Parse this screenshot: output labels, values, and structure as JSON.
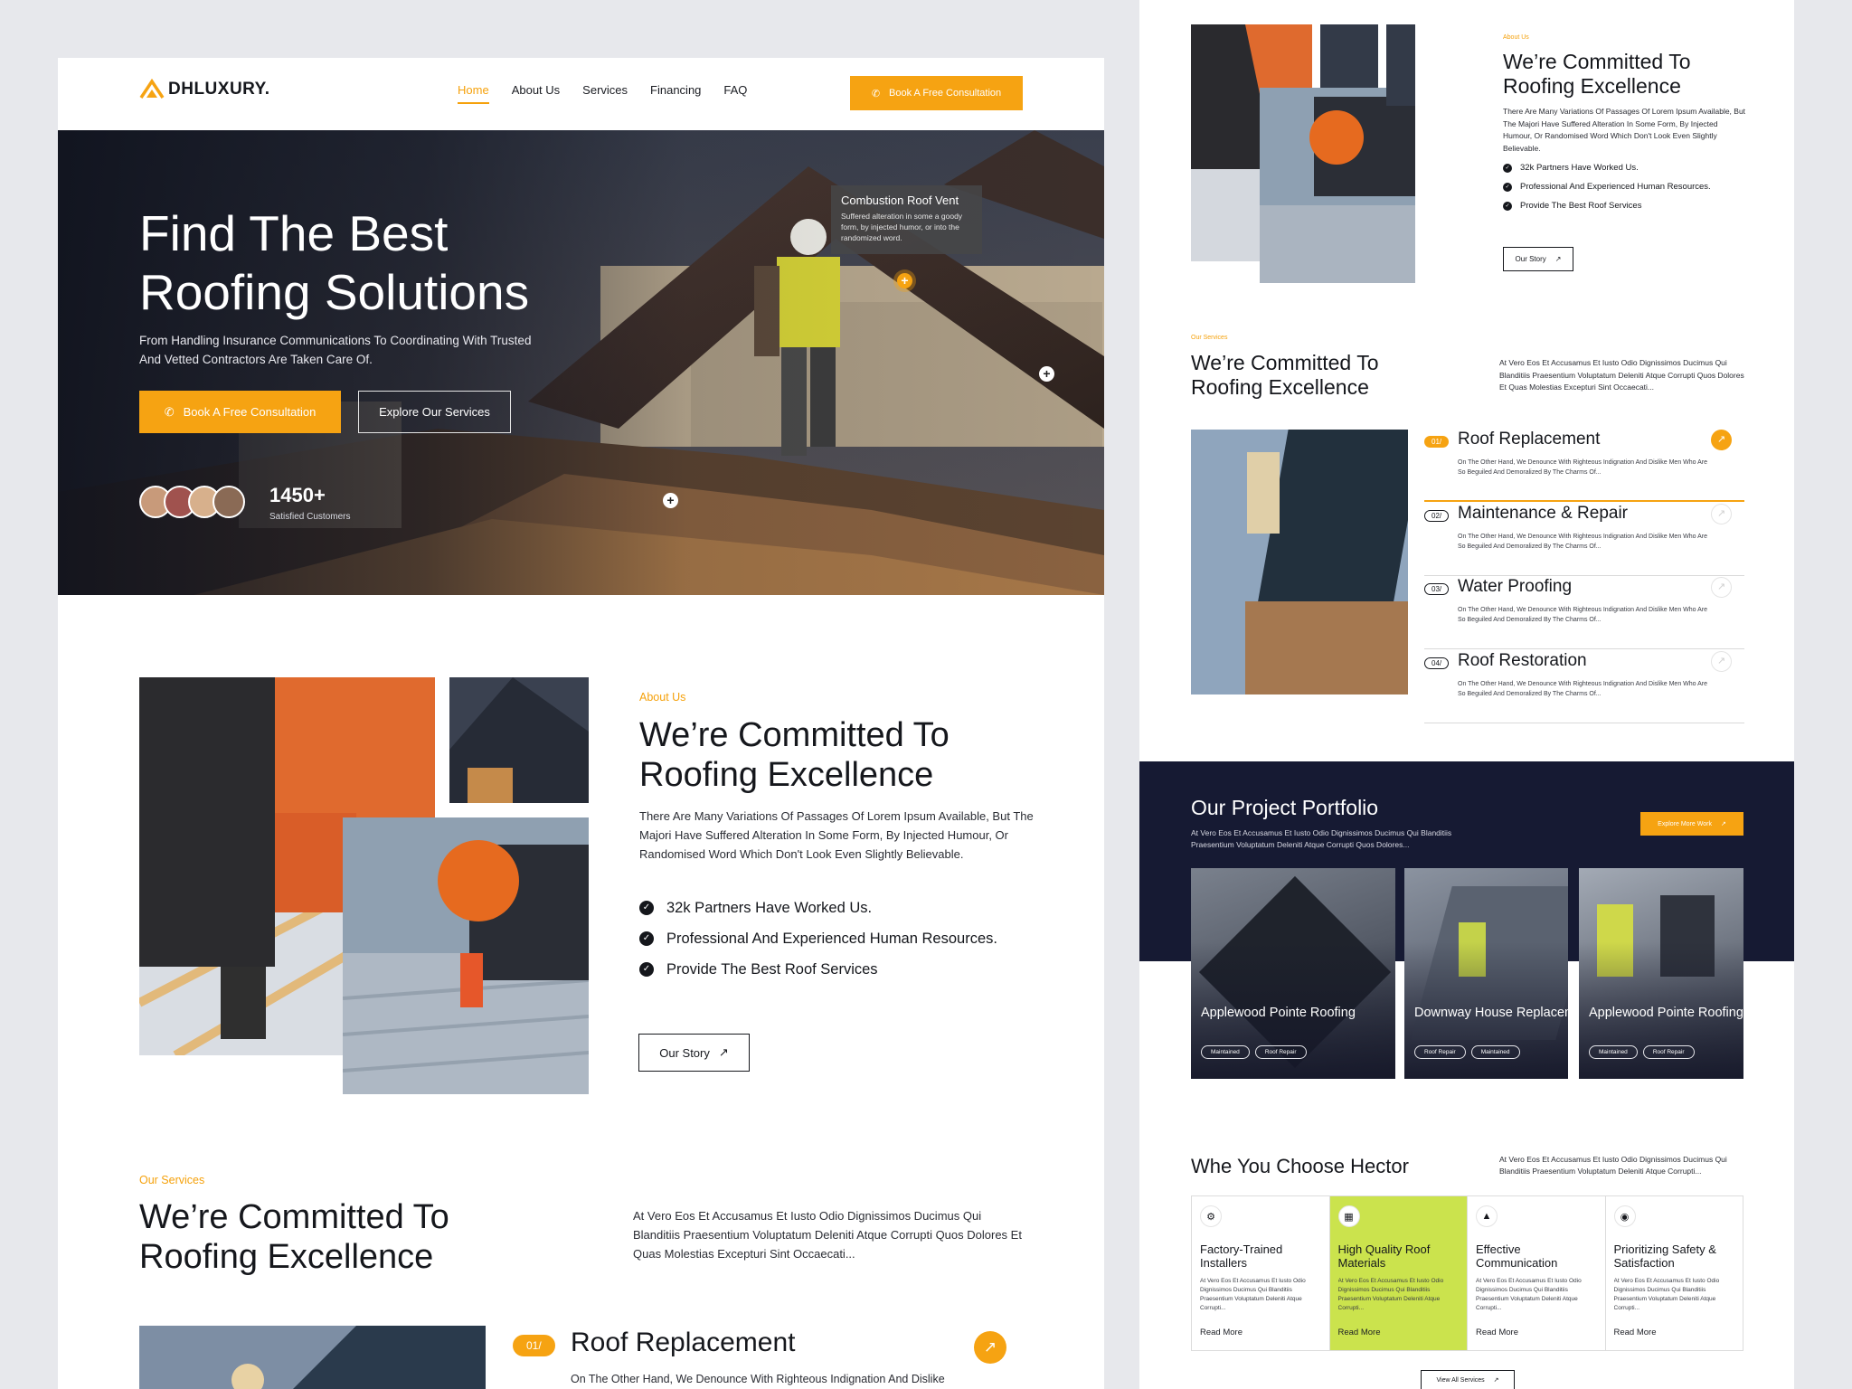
{
  "brand": {
    "name": "DHLUXURY.",
    "accent": "#f6a312",
    "dark": "#161a33",
    "highlight": "#cbe34d"
  },
  "nav": {
    "items": [
      "Home",
      "About Us",
      "Services",
      "Financing",
      "FAQ"
    ],
    "active": "Home",
    "cta": "Book A Free Consultation"
  },
  "hero": {
    "title": "Find The Best Roofing Solutions",
    "subtitle": "From Handling Insurance Communications To Coordinating With Trusted And Vetted Contractors Are Taken Care Of.",
    "primary_cta": "Book A Free Consultation",
    "secondary_cta": "Explore Our Services",
    "customers_count": "1450+",
    "customers_label": "Satisfied Customers",
    "tooltip_title": "Combustion Roof Vent",
    "tooltip_text": "Suffered alteration in some a goody form, by injected humor, or into the randomized word."
  },
  "about": {
    "tag": "About Us",
    "title": "We’re Committed To Roofing Excellence",
    "text": "There Are Many Variations Of Passages Of Lorem Ipsum Available, But The Majori Have Suffered Alteration In Some Form, By Injected Humour, Or Randomised Word Which Don't Look Even Slightly Believable.",
    "points": [
      "32k Partners Have Worked Us.",
      "Professional And Experienced Human Resources.",
      "Provide The Best Roof Services"
    ],
    "cta": "Our Story"
  },
  "services": {
    "tag": "Our Services",
    "title": "We’re Committed To Roofing Excellence",
    "description": "At Vero Eos Et Accusamus Et Iusto Odio Dignissimos Ducimus Qui Blanditiis Praesentium Voluptatum Deleniti Atque Corrupti Quos Dolores Et Quas Molestias Excepturi Sint Occaecati...",
    "items": [
      {
        "num": "01/",
        "name": "Roof Replacement",
        "text": "On The Other Hand, We Denounce With Righteous Indignation And Dislike Men Who Are So Beguiled And Demoralized By The Charms Of..."
      },
      {
        "num": "02/",
        "name": "Maintenance & Repair",
        "text": "On The Other Hand, We Denounce With Righteous Indignation And Dislike Men Who Are So Beguiled And Demoralized By The Charms Of..."
      },
      {
        "num": "03/",
        "name": "Water Proofing",
        "text": "On The Other Hand, We Denounce With Righteous Indignation And Dislike Men Who Are So Beguiled And Demoralized By The Charms Of..."
      },
      {
        "num": "04/",
        "name": "Roof Restoration",
        "text": "On The Other Hand, We Denounce With Righteous Indignation And Dislike Men Who Are So Beguiled And Demoralized By The Charms Of..."
      }
    ],
    "left_preview_text": "On The Other Hand, We Denounce With Righteous Indignation And Dislike"
  },
  "portfolio": {
    "title": "Our Project Portfolio",
    "description": "At Vero Eos Et Accusamus Et Iusto Odio Dignissimos Ducimus Qui Blanditiis Praesentium Voluptatum Deleniti Atque Corrupti Quos Dolores...",
    "cta": "Explore More Work",
    "projects": [
      {
        "name": "Applewood Pointe Roofing",
        "tags": [
          "Maintained",
          "Roof Repair"
        ]
      },
      {
        "name": "Downway House Replacement",
        "tags": [
          "Roof Repair",
          "Maintained"
        ]
      },
      {
        "name": "Applewood Pointe Roofing",
        "tags": [
          "Maintained",
          "Roof Repair"
        ]
      }
    ]
  },
  "why": {
    "title": "Whe You Choose Hector",
    "description": "At Vero Eos Et Accusamus Et Iusto Odio Dignissimos Ducimus Qui Blanditiis Praesentium Voluptatum Deleniti Atque Corrupti...",
    "features": [
      {
        "icon": "installer-icon",
        "title": "Factory-Trained Installers",
        "text": "At Vero Eos Et Accusamus Et Iusto Odio Dignissimos Ducimus Qui Blanditiis Praesentium Voluptatum Deleniti Atque Corrupti...",
        "link": "Read More"
      },
      {
        "icon": "materials-icon",
        "title": "High Quality Roof Materials",
        "text": "At Vero Eos Et Accusamus Et Iusto Odio Dignissimos Ducimus Qui Blanditiis Praesentium Voluptatum Deleniti Atque Corrupti...",
        "link": "Read More"
      },
      {
        "icon": "graduation-cap-icon",
        "title": "Effective Communication",
        "text": "At Vero Eos Et Accusamus Et Iusto Odio Dignissimos Ducimus Qui Blanditiis Praesentium Voluptatum Deleniti Atque Corrupti...",
        "link": "Read More"
      },
      {
        "icon": "safety-badge-icon",
        "title": "Prioritizing Safety & Satisfaction",
        "text": "At Vero Eos Et Accusamus Et Iusto Odio Dignissimos Ducimus Qui Blanditiis Praesentium Voluptatum Deleniti Atque Corrupti...",
        "link": "Read More"
      }
    ],
    "cta": "View All Services"
  }
}
